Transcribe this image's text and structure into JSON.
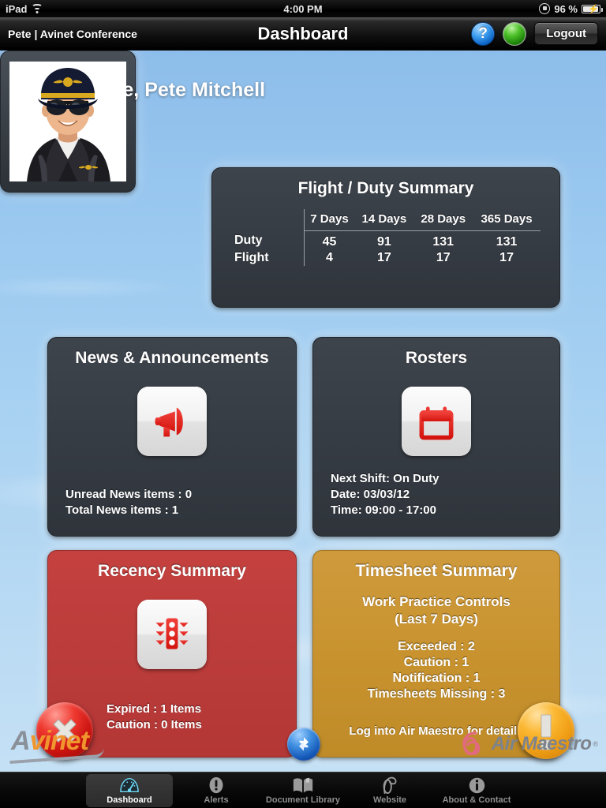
{
  "status_bar": {
    "device": "iPad",
    "wifi_icon": "wifi-icon",
    "time": "4:00 PM",
    "rotation_lock_icon": "rotation-lock-icon",
    "battery_percent": "96 %",
    "battery_icon": "battery-charging-icon"
  },
  "nav": {
    "left_title": "Pete | Avinet Conference",
    "title": "Dashboard",
    "help_label": "?",
    "help_icon": "help-icon",
    "status_orb_icon": "status-orb-icon",
    "logout_label": "Logout"
  },
  "welcome": "Welcome, Pete Mitchell",
  "avatar": {
    "icon": "pilot-avatar-photo",
    "alt": "Pete Mitchell"
  },
  "flight_duty": {
    "title": "Flight / Duty Summary",
    "columns": [
      "",
      "7 Days",
      "14 Days",
      "28 Days",
      "365 Days"
    ],
    "rows": [
      {
        "label": "Duty",
        "values": [
          "45",
          "91",
          "131",
          "131"
        ]
      },
      {
        "label": "Flight",
        "values": [
          "4",
          "17",
          "17",
          "17"
        ]
      }
    ]
  },
  "news": {
    "title": "News & Announcements",
    "icon": "megaphone-icon",
    "line1": "Unread News items : 0",
    "line2": "Total News items : 1"
  },
  "rosters": {
    "title": "Rosters",
    "icon": "calendar-icon",
    "line1": "Next Shift: On Duty",
    "line2": "Date: 03/03/12",
    "line3": "Time: 09:00 - 17:00"
  },
  "recency": {
    "title": "Recency Summary",
    "icon": "traffic-light-icon",
    "badge_icon": "error-cross-badge-icon",
    "line1": "Expired : 1 Items",
    "line2": "Caution : 0 Items"
  },
  "timesheet": {
    "title": "Timesheet Summary",
    "subtitle1": "Work Practice Controls",
    "subtitle2": "(Last 7 Days)",
    "badge_icon": "warning-exclamation-badge-icon",
    "stats": [
      "Exceeded : 2",
      "Caution : 1",
      "Notification : 1",
      "Timesheets Missing : 3"
    ],
    "footer": "Log into Air Maestro for details"
  },
  "footer": {
    "avinet_a": "A",
    "avinet_rest": "vinet",
    "refresh_icon": "refresh-icon",
    "airmaestro_text": "Air Maestro",
    "airmaestro_reg": "®",
    "airmaestro_icon": "air-maestro-ribbon-icon"
  },
  "tabs": [
    {
      "label": "Dashboard",
      "icon": "gauge-icon",
      "active": true
    },
    {
      "label": "Alerts",
      "icon": "alert-icon",
      "active": false
    },
    {
      "label": "Document Library",
      "icon": "book-icon",
      "active": false
    },
    {
      "label": "Website",
      "icon": "website-icon",
      "active": false
    },
    {
      "label": "About & Contact",
      "icon": "info-icon",
      "active": false
    }
  ],
  "colors": {
    "sky_top": "#8dbdea",
    "sky_bottom": "#c4e0f5",
    "card_dark": "#373d45",
    "card_red": "#bb3c3b",
    "card_gold": "#c8932f",
    "accent_red": "#e53229",
    "accent_orange": "#f0962f",
    "tab_active": "#ffffff"
  }
}
